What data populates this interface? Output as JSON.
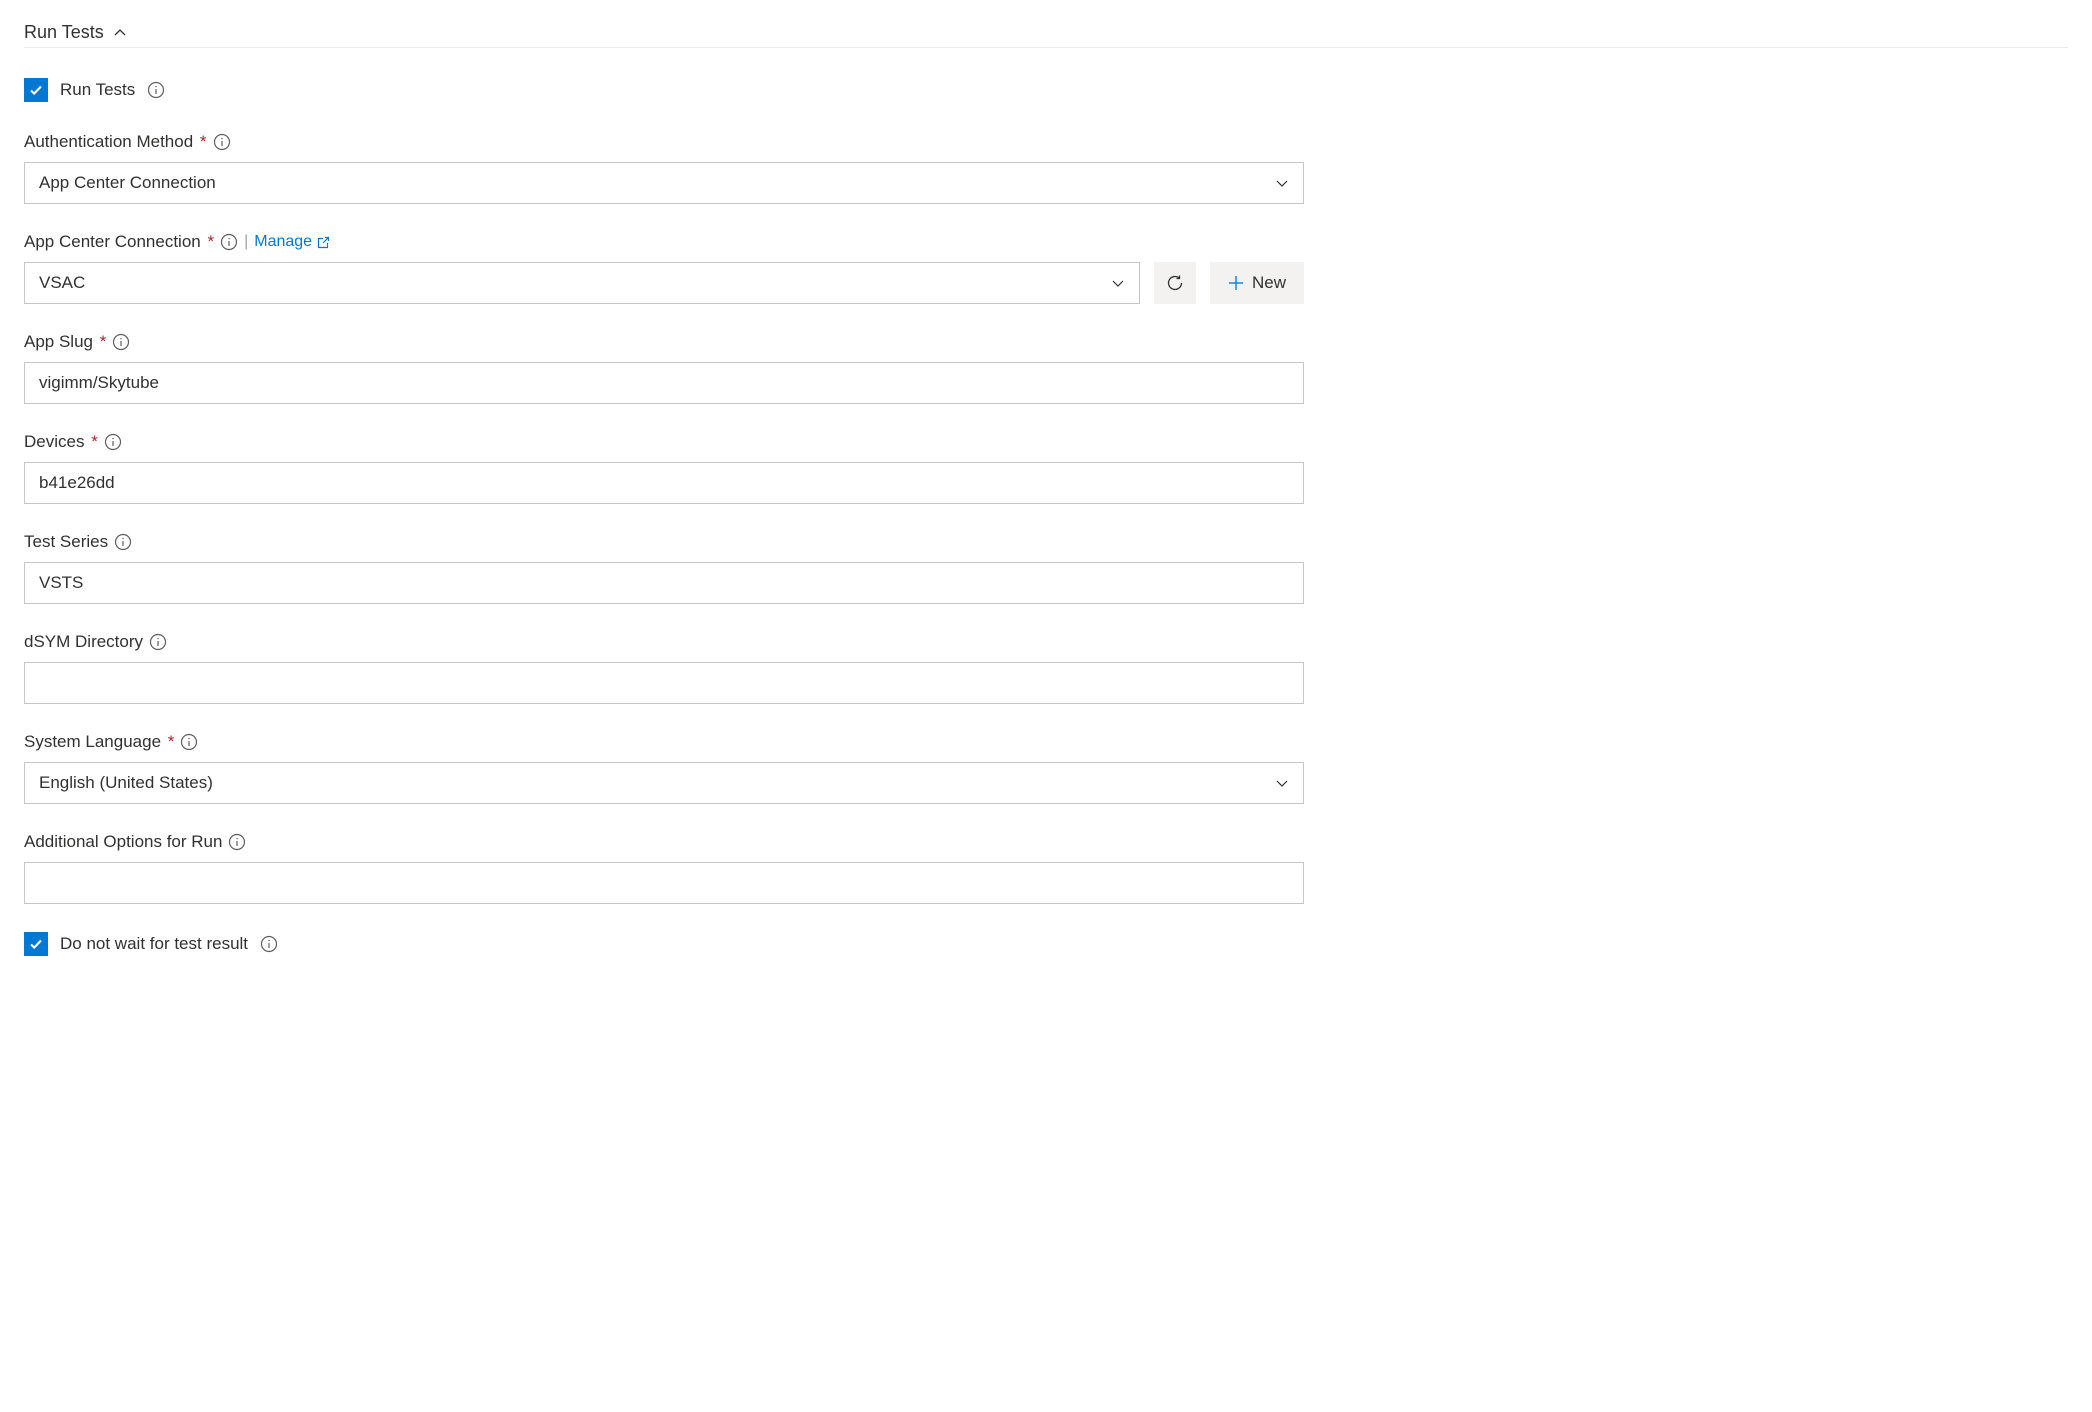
{
  "section": {
    "title": "Run Tests"
  },
  "fields": {
    "runTests": {
      "label": "Run Tests",
      "checked": true
    },
    "authMethod": {
      "label": "Authentication Method",
      "required": true,
      "value": "App Center Connection"
    },
    "connection": {
      "label": "App Center Connection",
      "required": true,
      "manageLink": "Manage",
      "value": "VSAC",
      "newButton": "New"
    },
    "appSlug": {
      "label": "App Slug",
      "required": true,
      "value": "vigimm/Skytube"
    },
    "devices": {
      "label": "Devices",
      "required": true,
      "value": "b41e26dd"
    },
    "testSeries": {
      "label": "Test Series",
      "required": false,
      "value": "VSTS"
    },
    "dsym": {
      "label": "dSYM Directory",
      "required": false,
      "value": ""
    },
    "sysLang": {
      "label": "System Language",
      "required": true,
      "value": "English (United States)"
    },
    "addOptions": {
      "label": "Additional Options for Run",
      "required": false,
      "value": ""
    },
    "noWait": {
      "label": "Do not wait for test result",
      "checked": true
    }
  }
}
